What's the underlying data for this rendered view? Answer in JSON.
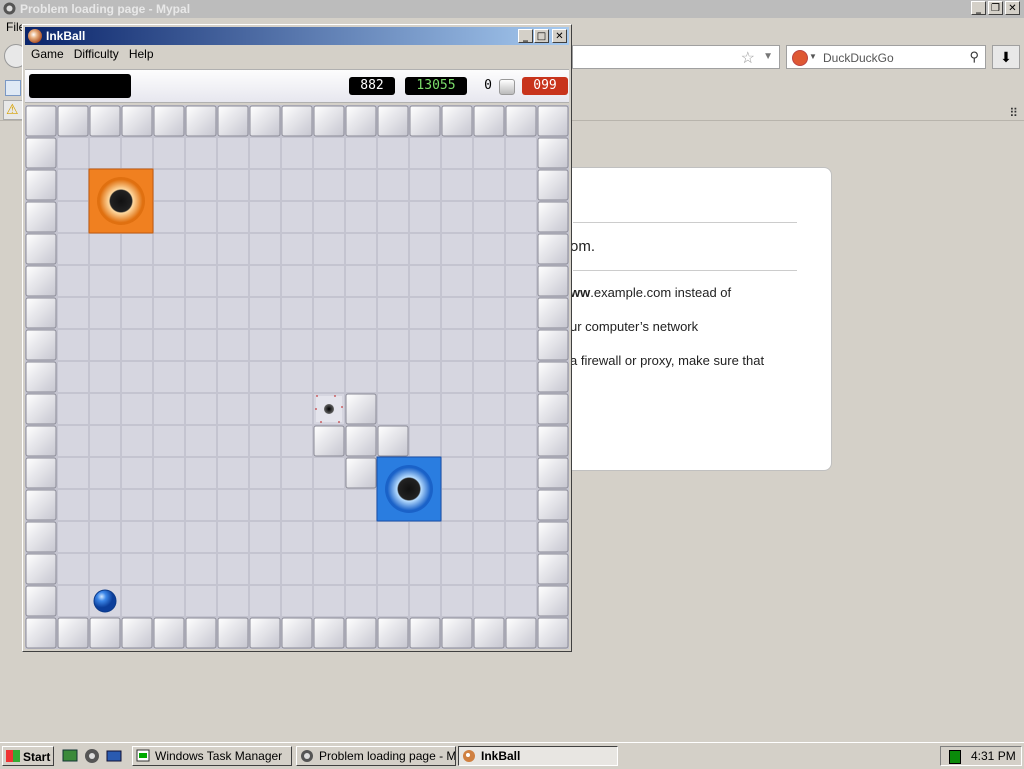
{
  "browser": {
    "title": "Problem loading page - Mypal",
    "menu_file": "File",
    "search_placeholder": "DuckDuckGo",
    "error": {
      "message": "om.",
      "line1": "ww.example.com instead of",
      "line1_bold": "ww",
      "line1_rest": ".example.com instead of",
      "line2": "ur computer’s network",
      "line3": "a firewall or proxy, make sure that"
    }
  },
  "inkball": {
    "title": "InkBall",
    "menu": [
      "Game",
      "Difficulty",
      "Help"
    ],
    "score": "882",
    "high_score": "13055",
    "balls_count": "0",
    "time": "099"
  },
  "taskbar": {
    "start": "Start",
    "buttons": [
      "Windows Task Manager",
      "Problem loading page - M...",
      "InkBall"
    ],
    "active": "InkBall",
    "clock": "4:31 PM"
  },
  "colors": {
    "hole_orange": "#f08020",
    "hole_blue": "#2a7de0",
    "ball_blue": "#1f5fd0",
    "time_bg": "#c8341c",
    "high_score_fg": "#7bdc6a"
  }
}
